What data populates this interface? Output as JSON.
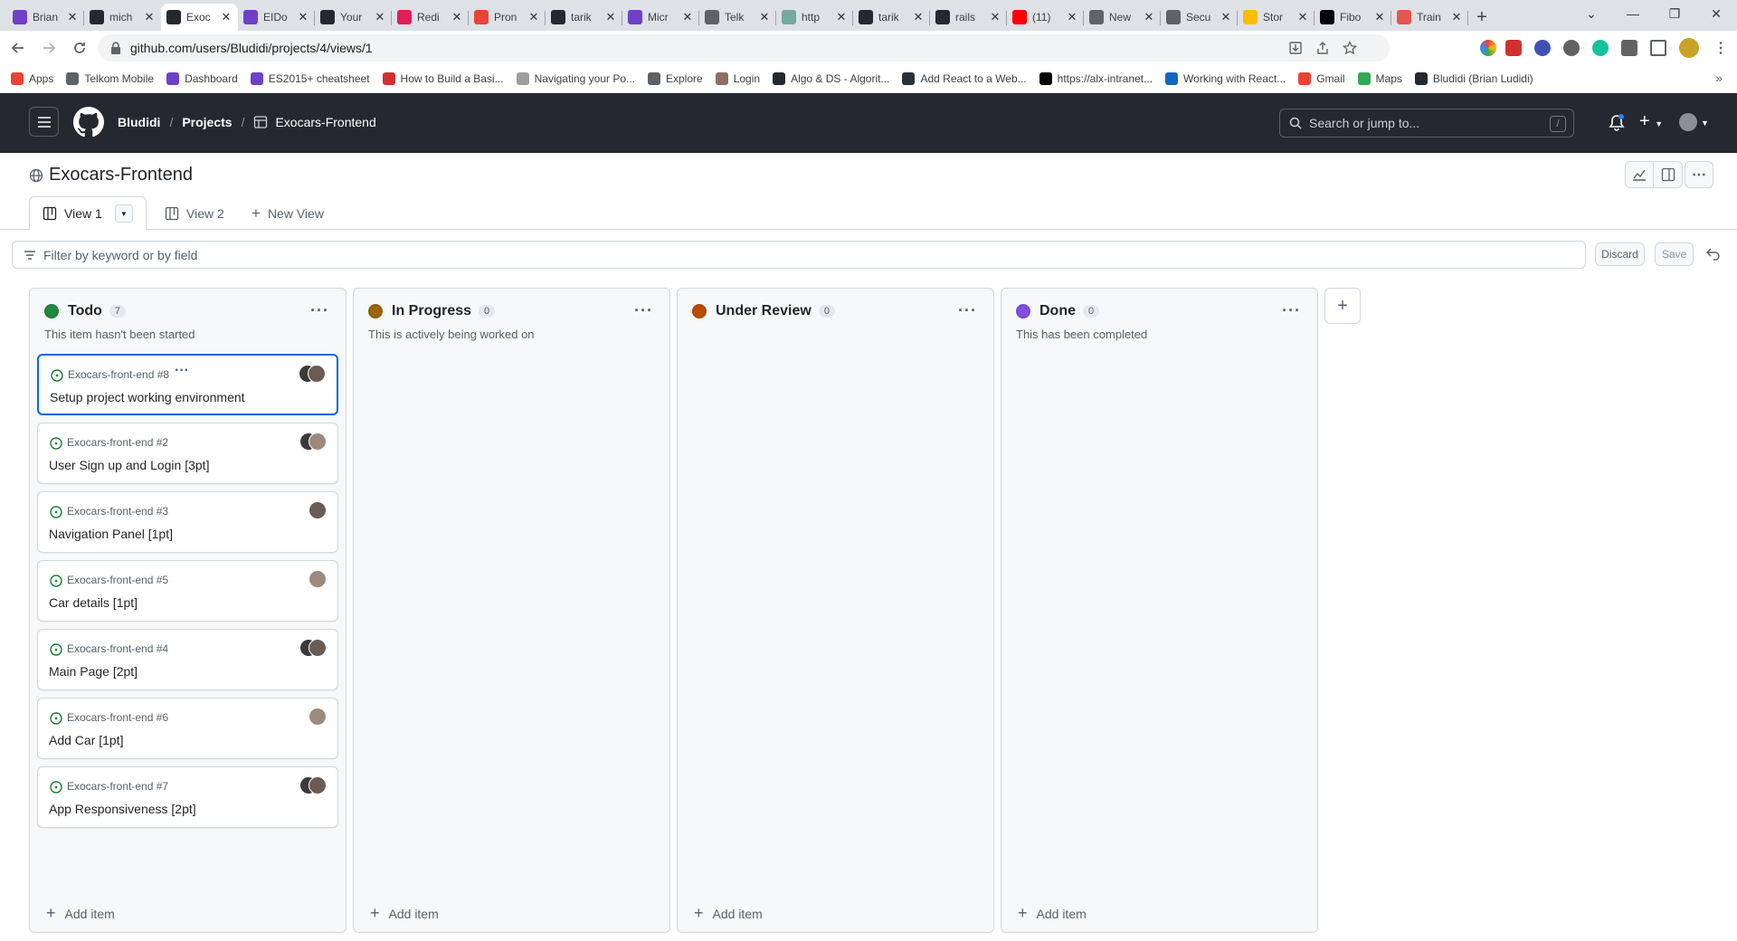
{
  "browser": {
    "tabs": [
      {
        "label": "Brian",
        "color": "#6e40c9"
      },
      {
        "label": "mich",
        "color": "#24292f"
      },
      {
        "label": "Exoc",
        "color": "#24292f"
      },
      {
        "label": "EIDo",
        "color": "#6e40c9"
      },
      {
        "label": "Your",
        "color": "#24292f"
      },
      {
        "label": "Redi",
        "color": "#e01e5a"
      },
      {
        "label": "Pron",
        "color": "#ea4335"
      },
      {
        "label": "tarik",
        "color": "#24292f"
      },
      {
        "label": "Micr",
        "color": "#6e40c9"
      },
      {
        "label": "Telk",
        "color": "#5f6368"
      },
      {
        "label": "http",
        "color": "#74aa9c"
      },
      {
        "label": "tarik",
        "color": "#24292f"
      },
      {
        "label": "rails",
        "color": "#24292f"
      },
      {
        "label": "(11)",
        "color": "#ff0000"
      },
      {
        "label": "New",
        "color": "#5f6368"
      },
      {
        "label": "Secu",
        "color": "#5f6368"
      },
      {
        "label": "Stor",
        "color": "#fbbc04"
      },
      {
        "label": "Fibo",
        "color": "#000000"
      },
      {
        "label": "Train",
        "color": "#e65550"
      }
    ],
    "url": "github.com/users/Bludidi/projects/4/views/1",
    "bookmarks": [
      {
        "label": "Apps",
        "color": "#ea4335"
      },
      {
        "label": "Telkom Mobile",
        "color": "#5f6368"
      },
      {
        "label": "Dashboard",
        "color": "#6e40c9"
      },
      {
        "label": "ES2015+ cheatsheet",
        "color": "#6e40c9"
      },
      {
        "label": "How to Build a Basi...",
        "color": "#d32f2f"
      },
      {
        "label": "Navigating your Po...",
        "color": "#9e9e9e"
      },
      {
        "label": "Explore",
        "color": "#5f6368"
      },
      {
        "label": "Login",
        "color": "#8d6e63"
      },
      {
        "label": "Algo & DS - Algorit...",
        "color": "#24292f"
      },
      {
        "label": "Add React to a Web...",
        "color": "#263238"
      },
      {
        "label": "https://alx-intranet...",
        "color": "#000000"
      },
      {
        "label": "Working with React...",
        "color": "#1565c0"
      },
      {
        "label": "Gmail",
        "color": "#ea4335"
      },
      {
        "label": "Maps",
        "color": "#34a853"
      },
      {
        "label": "Bludidi (Brian Ludidi)",
        "color": "#24292f"
      }
    ]
  },
  "header": {
    "user": "Bludidi",
    "projects": "Projects",
    "project": "Exocars-Frontend",
    "search_placeholder": "Search or jump to...",
    "search_shortcut": "/"
  },
  "project": {
    "title": "Exocars-Frontend",
    "views": [
      "View 1",
      "View 2",
      "New View"
    ],
    "filter_placeholder": "Filter by keyword or by field",
    "discard": "Discard",
    "save": "Save"
  },
  "columns": [
    {
      "name": "Todo",
      "count": "7",
      "color": "#1f883d",
      "description": "This item hasn't been started",
      "cards": [
        {
          "repo": "Exocars-front-end #8",
          "title": "Setup project working environment",
          "selected": true,
          "avatars": 2
        },
        {
          "repo": "Exocars-front-end #2",
          "title": "User Sign up and Login [3pt]",
          "avatars": 2
        },
        {
          "repo": "Exocars-front-end #3",
          "title": "Navigation Panel [1pt]",
          "avatars": 1
        },
        {
          "repo": "Exocars-front-end #5",
          "title": "Car details [1pt]",
          "avatars": 1
        },
        {
          "repo": "Exocars-front-end #4",
          "title": "Main Page [2pt]",
          "avatars": 2
        },
        {
          "repo": "Exocars-front-end #6",
          "title": "Add Car [1pt]",
          "avatars": 1
        },
        {
          "repo": "Exocars-front-end #7",
          "title": "App Responsiveness [2pt]",
          "avatars": 2
        }
      ]
    },
    {
      "name": "In Progress",
      "count": "0",
      "color": "#9a6700",
      "description": "This is actively being worked on",
      "cards": []
    },
    {
      "name": "Under Review",
      "count": "0",
      "color": "#bc4c00",
      "description": "",
      "cards": []
    },
    {
      "name": "Done",
      "count": "0",
      "color": "#8250df",
      "description": "This has been completed",
      "cards": []
    }
  ],
  "add_item_label": "Add item",
  "add_column_label": "+"
}
